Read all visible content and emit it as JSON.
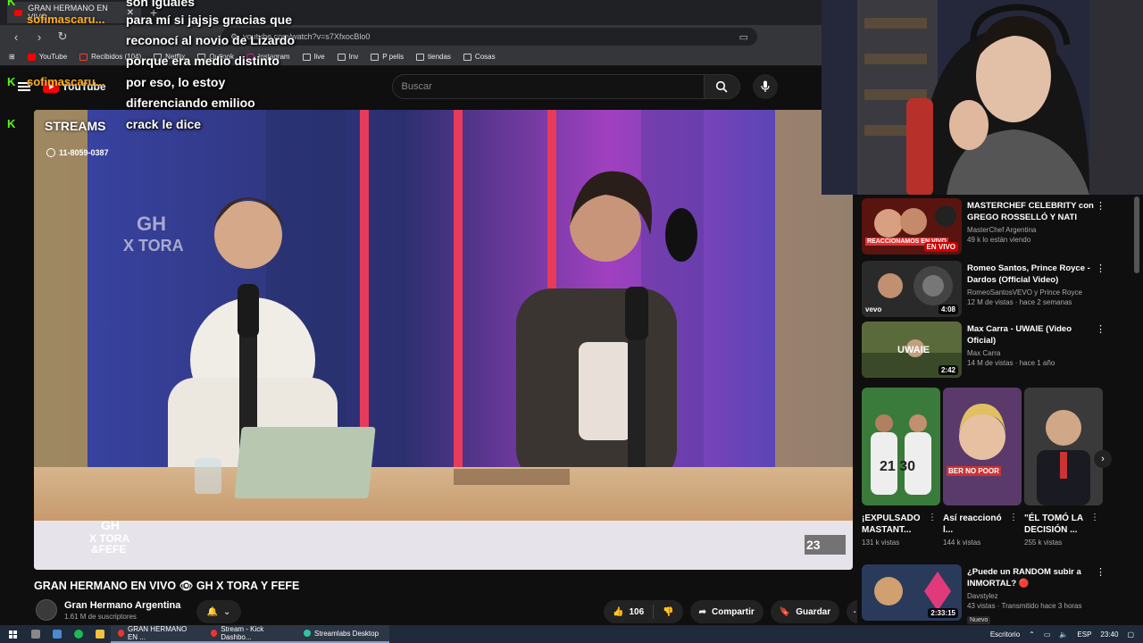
{
  "browser": {
    "tab_title": "GRAN HERMANO EN VIVO",
    "url": "youtube.com/watch?v=s7XfxocBlo0",
    "bookmarks": [
      "YouTube",
      "Recibidos (104)",
      "Netflix",
      "Outlook",
      "Instagram",
      "live",
      "Inv",
      "P pelis",
      "tiendas",
      "Cosas"
    ]
  },
  "youtube": {
    "logo_text": "YouTube",
    "search_placeholder": "Buscar"
  },
  "chat": [
    {
      "user": "sofimascaru...",
      "msg": "son iguales"
    },
    {
      "user": "",
      "msg": "para mí si jajsjs gracias que"
    },
    {
      "user": "",
      "msg": "reconocí al novio de Lizardo"
    },
    {
      "user": "",
      "msg": "porque era medio distinto"
    },
    {
      "user": "sofimascaru...",
      "msg": "por eso, lo estoy"
    },
    {
      "user": "",
      "msg": "diferenciando emilioo"
    },
    {
      "user": "sofimascaru...",
      "msg": "crack le dice"
    }
  ],
  "overlay": {
    "streams_label": "STREAMS",
    "phone": "11-8059-0387",
    "gh_logo_line1": "GH",
    "gh_logo_line2": "X TORA",
    "gh_logo_line3": "&FEFE",
    "channel_num": "23"
  },
  "video": {
    "title": "GRAN HERMANO EN VIVO 👁 GH X TORA Y FEFE",
    "channel": "Gran Hermano Argentina",
    "subs": "1.61 M de suscriptores",
    "likes": "106",
    "share": "Compartir",
    "save": "Guardar"
  },
  "recs": [
    {
      "title": "MASTERCHEF CELEBRITY con GREGO ROSSELLÓ Y NATI JOTA",
      "channel": "MasterChef Argentina",
      "meta": "49 k lo están viendo",
      "badge": "EN VIVO",
      "thumb_text": "REACCIONAMOS EN VIVO"
    },
    {
      "title": "Romeo Santos, Prince Royce - Dardos (Official Video)",
      "channel": "RomeoSantosVEVO y Prince Royce",
      "meta": "12 M de vistas · hace 2 semanas",
      "badge": "4:08",
      "thumb_text": "vevo"
    },
    {
      "title": "Max Carra - UWAIE (Video Oficial)",
      "channel": "Max Carra",
      "meta": "14 M de vistas · hace 1 año",
      "badge": "2:42",
      "thumb_text": "UWAIE"
    },
    {
      "title": "¿Puede un RANDOM subir a INMORTAL? 🔴",
      "channel": "Davstylez",
      "meta": "43 vistas · Transmitido hace 3 horas",
      "badge": "2:33:15",
      "extra": "Nuevo"
    }
  ],
  "shorts": [
    {
      "title": "¡EXPULSADO MASTANT...",
      "views": "131 k vistas",
      "thumb_text": "21 30"
    },
    {
      "title": "Así reaccionó l...",
      "views": "144 k vistas",
      "thumb_text": "BER NO POOR"
    },
    {
      "title": "\"ÉL TOMÓ LA DECISIÓN ...",
      "views": "255 k vistas",
      "thumb_text": ""
    }
  ],
  "taskbar": {
    "apps": [
      "GRAN HERMANO EN ...",
      "Stream - Kick Dashbo...",
      "Streamlabs Desktop"
    ],
    "desktop_label": "Escritorio",
    "lang": "ESP",
    "time": "23:40"
  }
}
